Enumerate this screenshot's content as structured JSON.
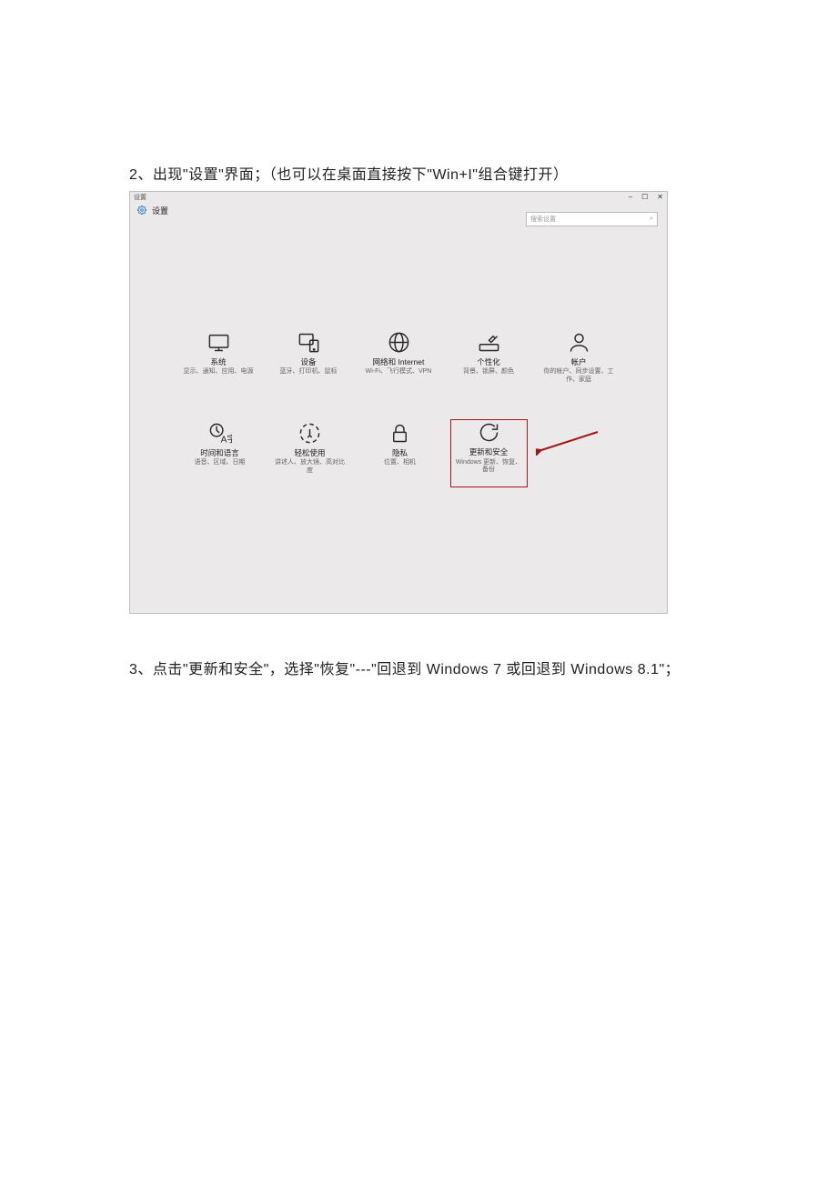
{
  "step2": "2、出现\"设置\"界面；（也可以在桌面直接按下\"Win+I\"组合键打开）",
  "step3": "3、点击\"更新和安全\"，选择\"恢复\"---\"回退到 Windows 7 或回退到 Windows 8.1\"；",
  "window": {
    "app_title": "设置",
    "header_title": "设置",
    "search_placeholder": "搜索设置",
    "btn_min": "–",
    "btn_max": "☐",
    "btn_close": "✕"
  },
  "tiles": [
    {
      "title": "系统",
      "desc": "显示、通知、应用、电源"
    },
    {
      "title": "设备",
      "desc": "蓝牙、打印机、鼠标"
    },
    {
      "title": "网络和 Internet",
      "desc": "Wi-Fi、飞行模式、VPN"
    },
    {
      "title": "个性化",
      "desc": "背景、锁屏、颜色"
    },
    {
      "title": "帐户",
      "desc": "你的帐户、同步设置、工作、家庭"
    },
    {
      "title": "时间和语言",
      "desc": "语音、区域、日期"
    },
    {
      "title": "轻松使用",
      "desc": "讲述人、放大镜、高对比度"
    },
    {
      "title": "隐私",
      "desc": "位置、相机"
    },
    {
      "title": "更新和安全",
      "desc": "Windows 更新、恢复、备份"
    }
  ]
}
